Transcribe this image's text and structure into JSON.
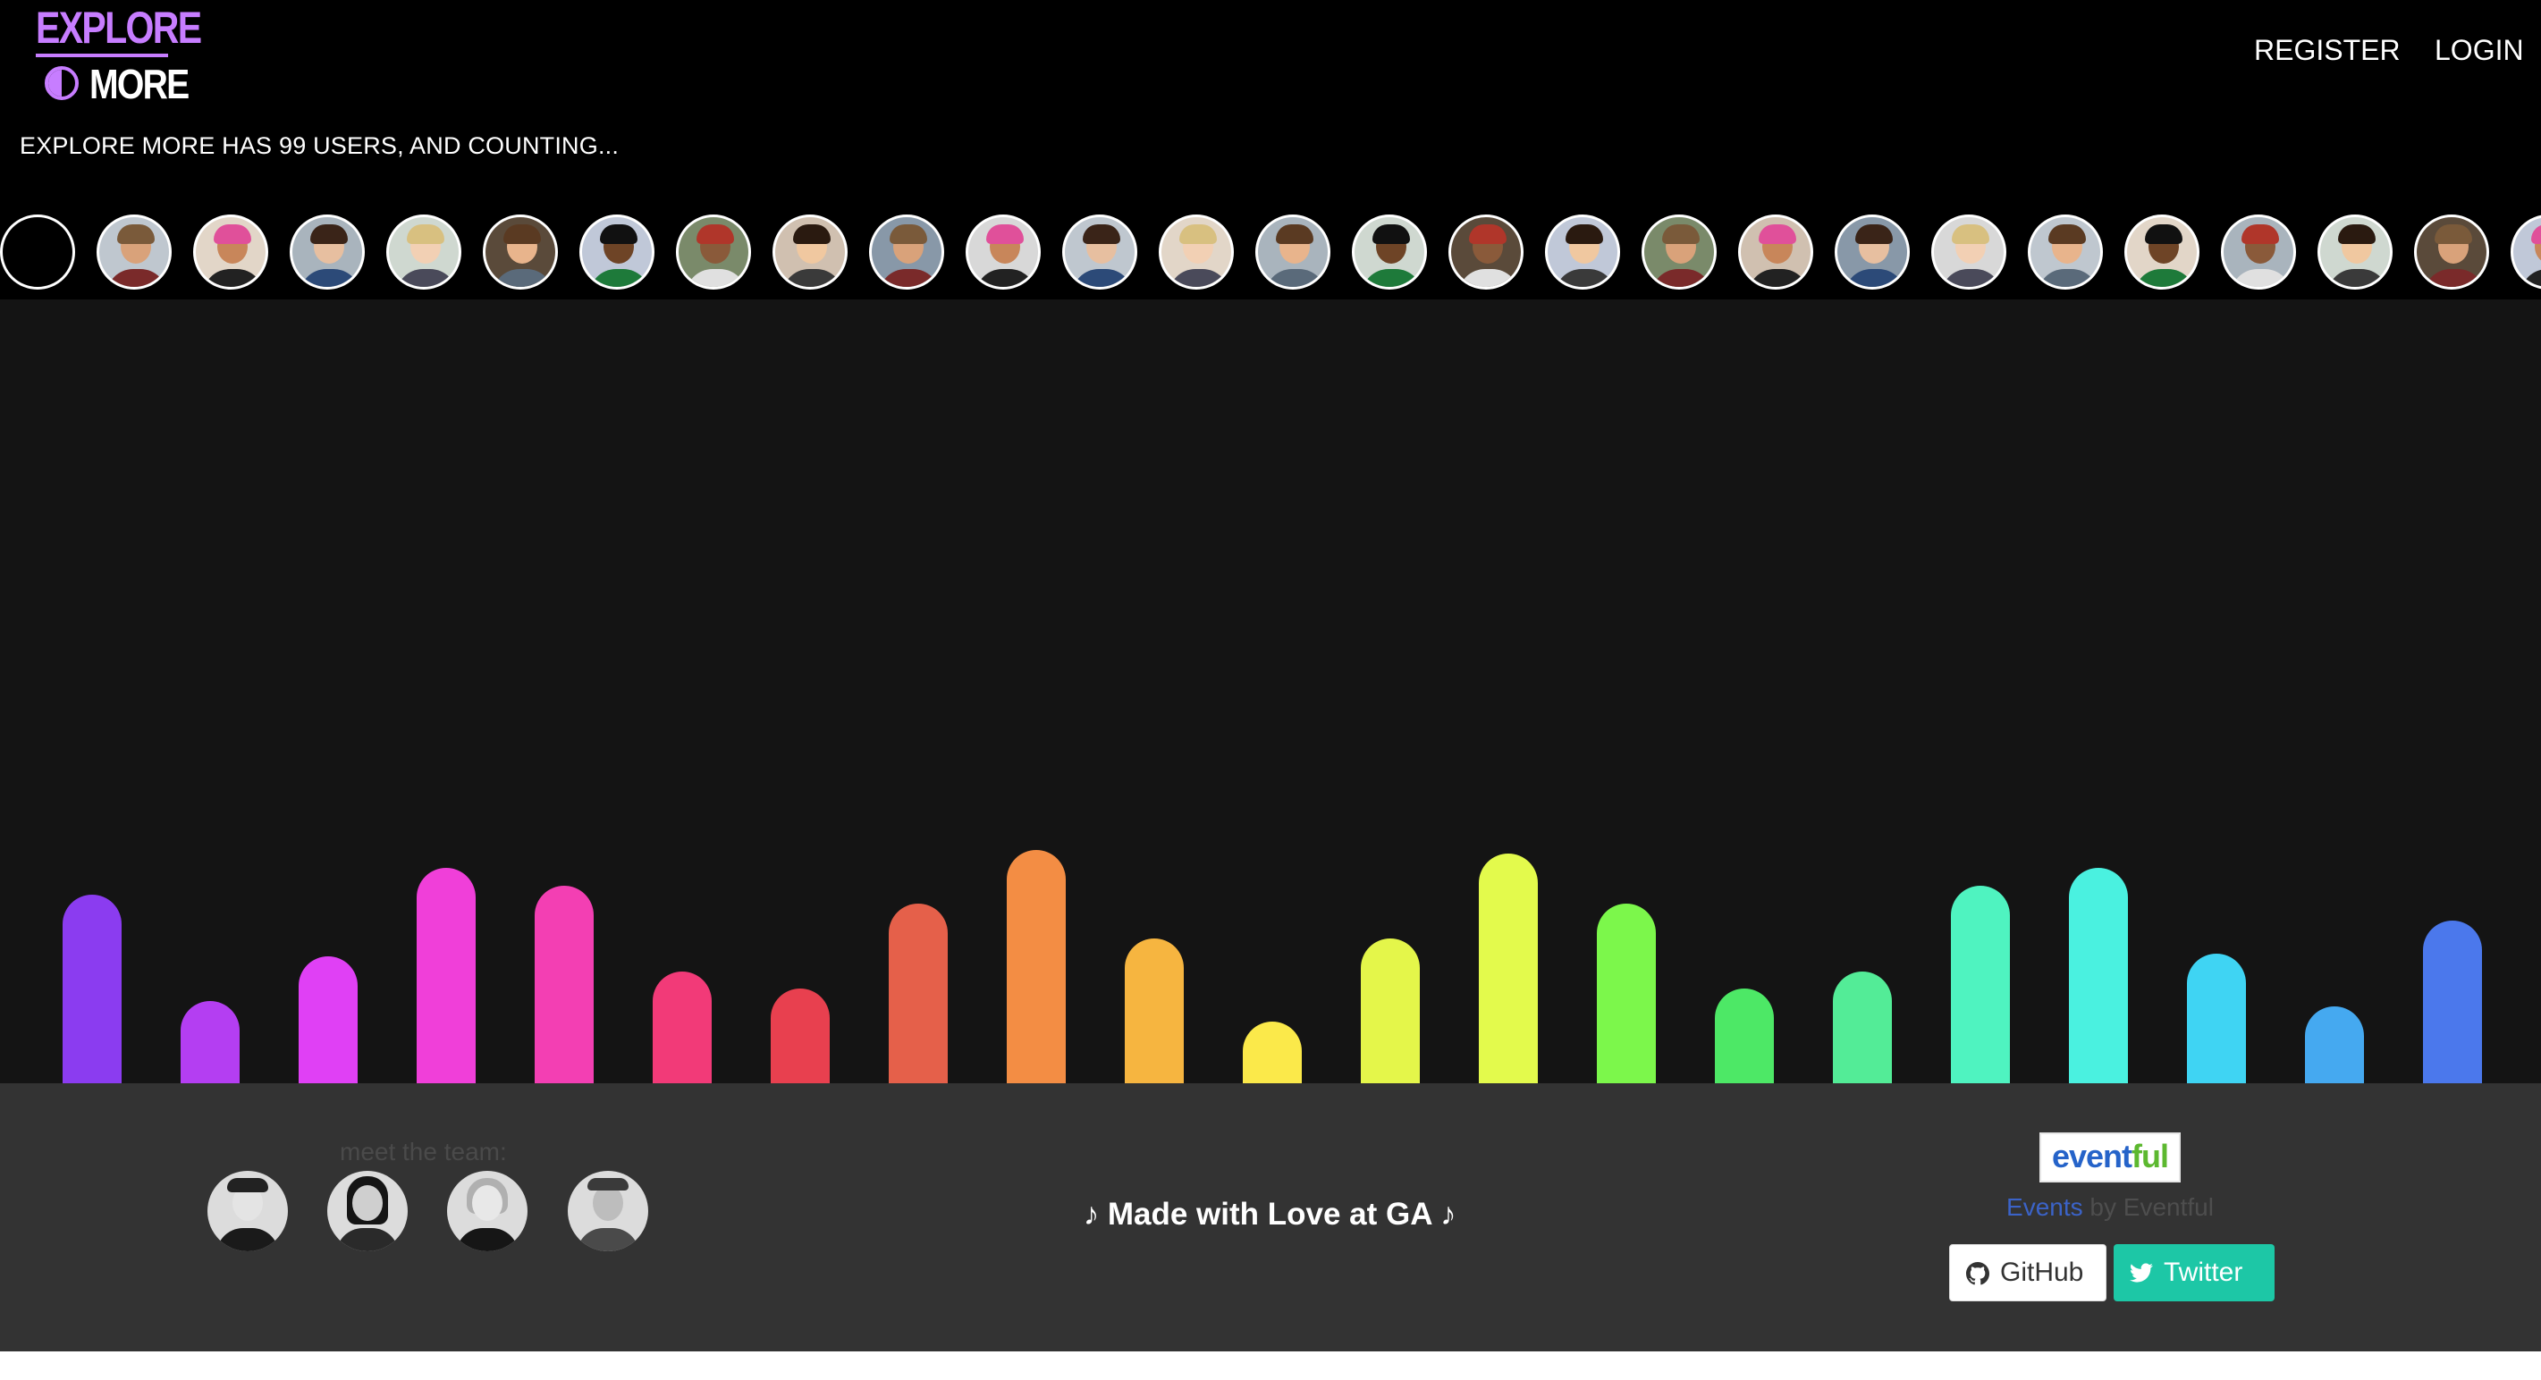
{
  "header": {
    "logo_line1": "EXPLORE",
    "logo_line2": "MORE",
    "nav": {
      "register": "REGISTER",
      "login": "LOGIN"
    },
    "user_count_text": "EXPLORE MORE HAS 99 USERS, AND COUNTING..."
  },
  "visualizer": {
    "bar_levels": [
      0.64,
      0.28,
      0.43,
      0.73,
      0.67,
      0.38,
      0.32,
      0.61,
      0.79,
      0.49,
      0.21,
      0.49,
      0.78,
      0.61,
      0.32,
      0.38,
      0.67,
      0.73,
      0.44,
      0.26,
      0.55
    ],
    "bar_colors": [
      "#8b3cf0",
      "#b43ef2",
      "#e040f5",
      "#f03fd9",
      "#f33fb3",
      "#f23a78",
      "#e8404f",
      "#e5604a",
      "#f38d44",
      "#f6b540",
      "#fbe94a",
      "#e4f64a",
      "#e3fa4c",
      "#7cf74b",
      "#4de866",
      "#53ec97",
      "#4ff3c0",
      "#4af1e0",
      "#3fd4f3",
      "#45a9f0",
      "#4b78ec"
    ]
  },
  "footer": {
    "team_heading": "meet the team:",
    "made_with": "♪ Made with Love at GA ♪",
    "eventful_logo": {
      "part1": "event",
      "part2": "ful"
    },
    "events_link": "Events",
    "events_by": "by Eventful",
    "github_label": "GitHub",
    "twitter_label": "Twitter"
  },
  "colors": {
    "header_bg": "#000000",
    "visualizer_bg": "#141414",
    "footer_bg": "#333333",
    "logo_accent": "#c77dff",
    "twitter_button": "#1dc7a6",
    "events_link": "#3b63c8"
  }
}
